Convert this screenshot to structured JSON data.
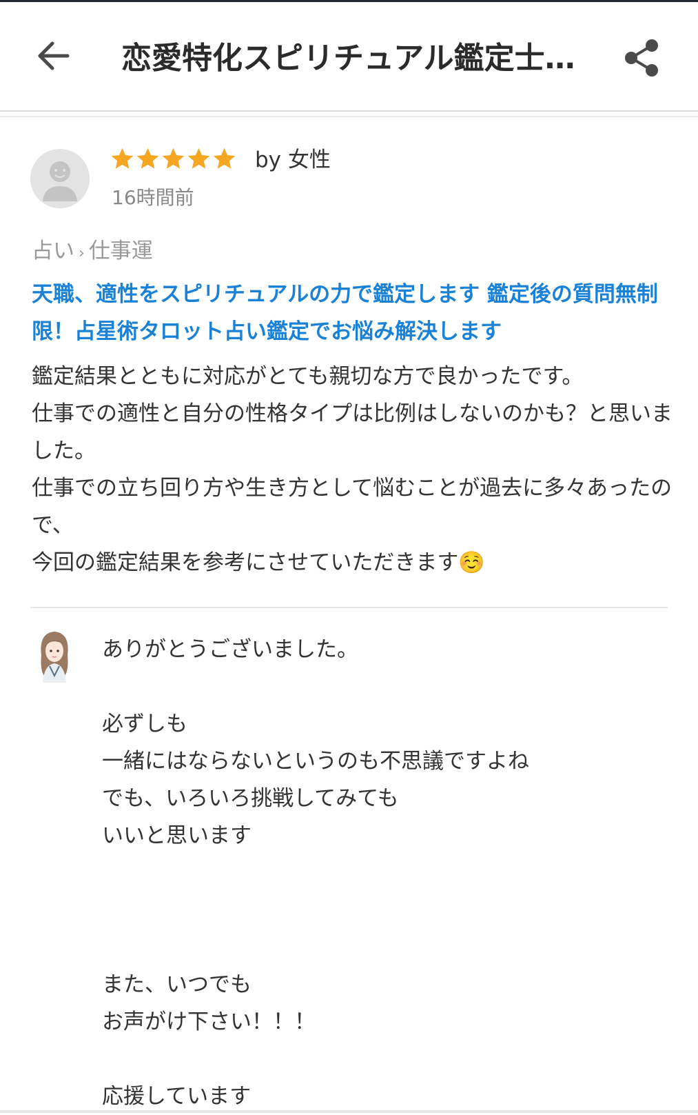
{
  "header": {
    "title": "恋愛特化スピリチュアル鑑定士…",
    "back_icon": "arrow-left-icon",
    "share_icon": "share-icon"
  },
  "review": {
    "avatar_icon": "default-user-avatar-icon",
    "rating": 5,
    "rating_max": 5,
    "star_color": "#f5a623",
    "by_label": "by 女性",
    "time": "16時間前",
    "breadcrumb": {
      "category": "占い",
      "separator": "›",
      "subcategory": "仕事運"
    },
    "service_title": "天職、適性をスピリチュアルの力で鑑定します 鑑定後の質問無制限！占星術タロット占い鑑定でお悩み解決します",
    "link_color": "#1a82d6",
    "body": "鑑定結果とともに対応がとても親切な方で良かったです。\n仕事での適性と自分の性格タイプは比例はしないのかも？と思いました。\n仕事での立ち回り方や生き方として悩むことが過去に多々あったので、\n今回の鑑定結果を参考にさせていただきます☺️"
  },
  "reply": {
    "avatar_icon": "seller-avatar-illustration",
    "body": "ありがとうございました。\n\n必ずしも\n一緒にはならないというのも不思議ですよね\nでも、いろいろ挑戦してみても\nいいと思います\n\n\n\nまた、いつでも\nお声がけ下さい！！！\n\n応援しています"
  }
}
